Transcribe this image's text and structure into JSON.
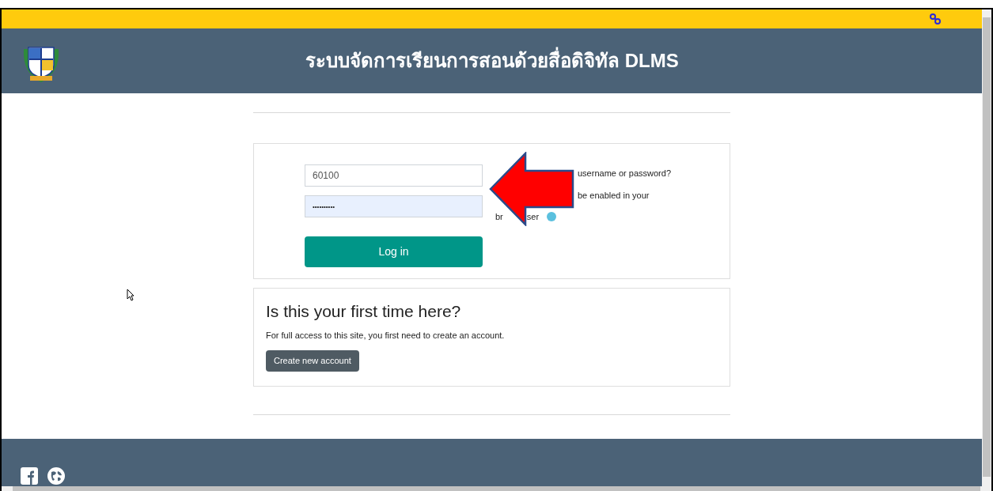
{
  "header": {
    "title": "ระบบจัดการเรียนการสอนด้วยสื่อดิจิทัล DLMS"
  },
  "login": {
    "username": {
      "value": "60100"
    },
    "password": {
      "value": "••••••••••"
    },
    "button": "Log in",
    "help_lines": [
      [
        "username or password?"
      ],
      [
        "be enabled in your"
      ],
      [
        "br",
        "ser"
      ]
    ]
  },
  "signup": {
    "heading": "Is this your first time here?",
    "text": "For full access to this site, you first need to create an account.",
    "button": "Create new account"
  }
}
